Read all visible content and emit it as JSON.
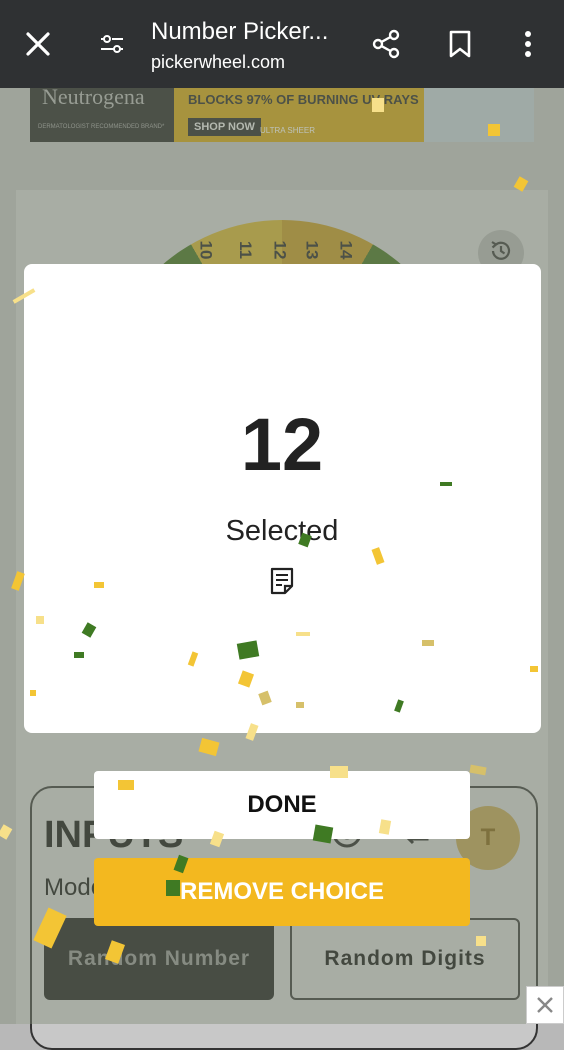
{
  "browser": {
    "title": "Number Picker...",
    "url": "pickerwheel.com",
    "icons": [
      "close-icon",
      "site-settings-icon",
      "share-icon",
      "bookmark-icon",
      "more-vert-icon"
    ]
  },
  "ad": {
    "brand": "Neutrogena",
    "brand_sub": "DERMATOLOGIST RECOMMENDED BRAND*",
    "headline": "BLOCKS 97% OF BURNING UV RAYS",
    "cta": "SHOP NOW",
    "tagline": "ULTRA SHEER"
  },
  "wheel": {
    "visible_numbers": [
      "10",
      "11",
      "12",
      "13",
      "14"
    ]
  },
  "inputs": {
    "title": "INPUTS",
    "mode_label": "Mode",
    "mode_active": "Random Number",
    "mode_inactive": "Random Digits",
    "avatar_letter": "T"
  },
  "modal": {
    "result": "12",
    "selected_label": "Selected"
  },
  "buttons": {
    "done": "DONE",
    "remove": "REMOVE CHOICE"
  },
  "colors": {
    "accent": "#f3b81f",
    "topbar": "#2f3133",
    "confetti_green": "#3f7a23",
    "confetti_yellow": "#f3c535"
  }
}
